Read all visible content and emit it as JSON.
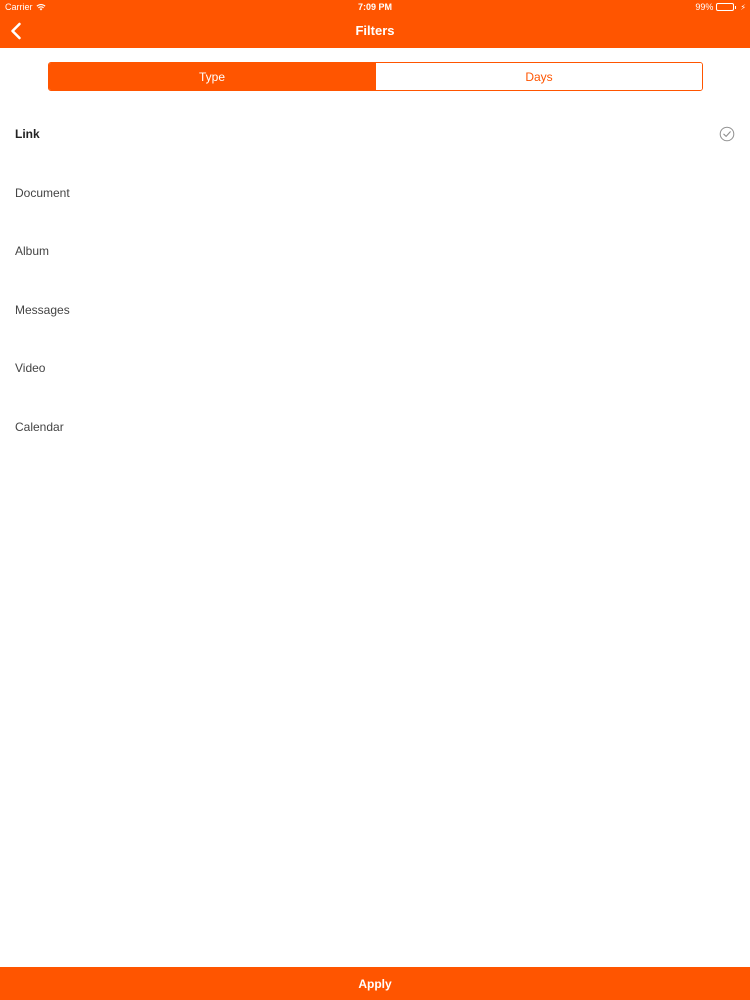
{
  "status_bar": {
    "carrier": "Carrier",
    "time": "7:09 PM",
    "battery": "99%",
    "battery_level": 0.99
  },
  "nav": {
    "title": "Filters",
    "back_icon": "chevron-left-icon"
  },
  "tabs": [
    {
      "label": "Type",
      "selected": true
    },
    {
      "label": "Days",
      "selected": false
    }
  ],
  "filters": [
    {
      "label": "Link",
      "checked": true
    },
    {
      "label": "Document",
      "checked": false
    },
    {
      "label": "Album",
      "checked": false
    },
    {
      "label": "Messages",
      "checked": false
    },
    {
      "label": "Video",
      "checked": false
    },
    {
      "label": "Calendar",
      "checked": false
    }
  ],
  "apply_label": "Apply",
  "colors": {
    "accent": "#FF5500",
    "battery": "#4CD964",
    "check": "#8E8E8E"
  }
}
